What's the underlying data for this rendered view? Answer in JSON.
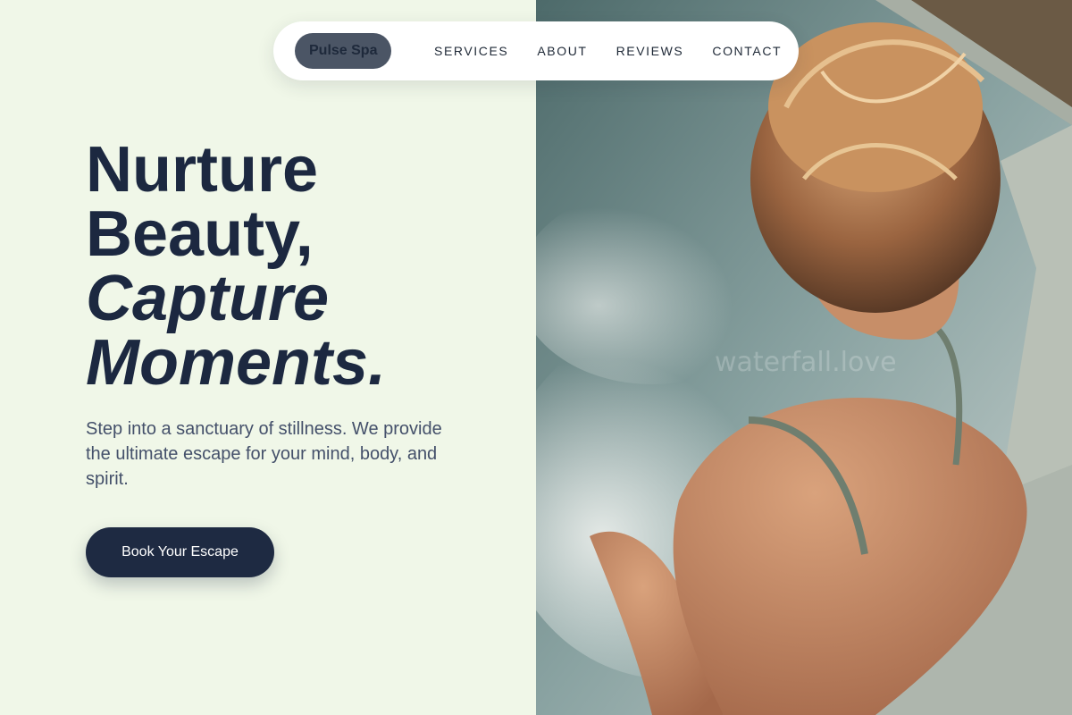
{
  "nav": {
    "brand": "Pulse Spa",
    "links": [
      "SERVICES",
      "ABOUT",
      "REVIEWS",
      "CONTACT"
    ]
  },
  "hero": {
    "line1": "Nurture",
    "line2": "Beauty,",
    "line3": "Capture",
    "line4": "Moments.",
    "lede": "Step into a sanctuary of stillness. We provide the ultimate escape for your mind, body, and spirit.",
    "cta": "Book Your Escape"
  },
  "image": {
    "watermark": "waterfall.love"
  },
  "colors": {
    "background": "#f0f7e8",
    "ink": "#1c2840",
    "brand_pill": "#4b5565",
    "cta": "#1e2a42"
  }
}
